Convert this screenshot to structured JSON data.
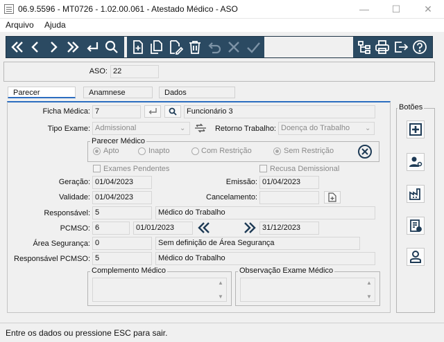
{
  "window": {
    "title": "06.9.5596 - MT0726 - 1.02.00.061 - Atestado Médico - ASO"
  },
  "menu": {
    "items": [
      "Arquivo",
      "Ajuda"
    ]
  },
  "header": {
    "aso_label": "ASO:",
    "aso_value": "22"
  },
  "tabs": [
    "Parecer",
    "Anamnese",
    "Dados"
  ],
  "form": {
    "ficha_label": "Ficha Médica:",
    "ficha_value": "7",
    "funcionario": "Funcionário 3",
    "tipo_exame_label": "Tipo Exame:",
    "tipo_exame_value": "Admissional",
    "retorno_label": "Retorno Trabalho:",
    "retorno_value": "Doença do Trabalho",
    "parecer_group": "Parecer Médico",
    "parecer_options": [
      "Apto",
      "Inapto",
      "Com Restrição",
      "Sem Restrição"
    ],
    "exames_pendentes": "Exames Pendentes",
    "recusa_demissional": "Recusa Demissional",
    "geracao_label": "Geração:",
    "geracao_value": "01/04/2023",
    "emissao_label": "Emissão:",
    "emissao_value": "01/04/2023",
    "validade_label": "Validade:",
    "validade_value": "01/04/2023",
    "cancelamento_label": "Cancelamento:",
    "cancelamento_value": "",
    "responsavel_label": "Responsável:",
    "responsavel_code": "5",
    "responsavel_name": "Médico do Trabalho",
    "pcmso_label": "PCMSO:",
    "pcmso_code": "6",
    "pcmso_start": "01/01/2023",
    "pcmso_end": "31/12/2023",
    "area_label": "Área Segurança:",
    "area_code": "0",
    "area_name": "Sem definição de Área Segurança",
    "resp_pcmso_label": "Responsável PCMSO:",
    "resp_pcmso_code": "5",
    "resp_pcmso_name": "Médico do Trabalho",
    "complemento_label": "Complemento Médico",
    "observacao_label": "Observação Exame Médico"
  },
  "side": {
    "title": "Botões"
  },
  "status": {
    "text": "Entre os dados ou pressione ESC para sair."
  },
  "colors": {
    "toolbar": "#2b4a62",
    "accent": "#2b6dc0",
    "side_icon": "#2b4a62"
  }
}
